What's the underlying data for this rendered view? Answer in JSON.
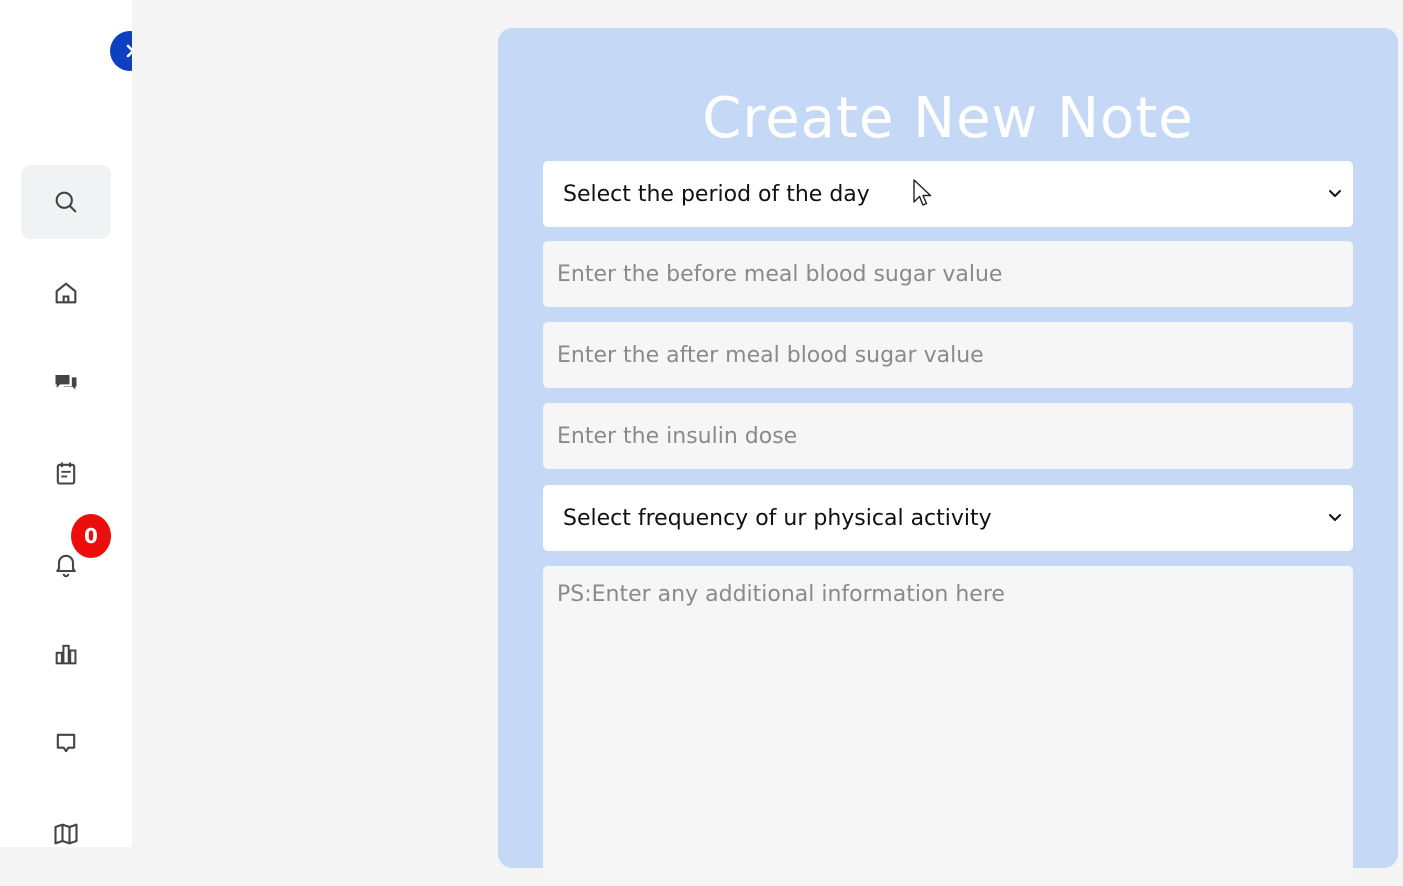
{
  "sidebar": {
    "toggle_icon": "chevron-right-icon",
    "items": [
      {
        "name": "search",
        "icon": "search-icon",
        "active": true
      },
      {
        "name": "home",
        "icon": "home-icon"
      },
      {
        "name": "chat",
        "icon": "chat-icon"
      },
      {
        "name": "notes",
        "icon": "notes-icon"
      },
      {
        "name": "notifications",
        "icon": "bell-icon"
      },
      {
        "name": "statistics",
        "icon": "chart-icon"
      },
      {
        "name": "messages",
        "icon": "message-icon"
      },
      {
        "name": "guide",
        "icon": "map-icon"
      }
    ],
    "notification_count": "0"
  },
  "form": {
    "title": "Create New Note",
    "period_select": "Select the period of the day",
    "before_meal_placeholder": "Enter the before meal blood sugar value",
    "after_meal_placeholder": "Enter the after meal blood sugar value",
    "insulin_placeholder": "Enter the insulin dose",
    "activity_select": "Select frequency of ur physical activity",
    "notes_placeholder": "PS:Enter any additional information here"
  },
  "colors": {
    "accent": "#0d3fc0",
    "card": "#c5d9f6",
    "badge": "#ee0d0d"
  }
}
